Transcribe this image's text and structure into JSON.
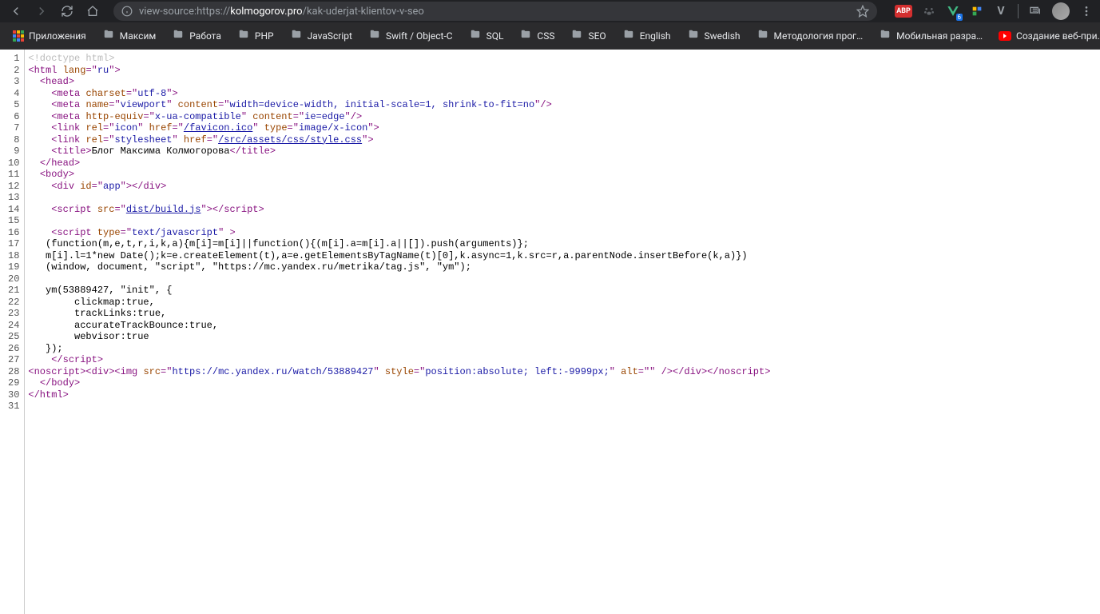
{
  "toolbar": {
    "url_prefix": "view-source:https://",
    "url_bold": "kolmogorov.pro",
    "url_rest": "/kak-uderjat-klientov-v-seo",
    "abp": "ABP",
    "badge": "6"
  },
  "bookmarks": [
    {
      "label": "Приложения",
      "type": "apps"
    },
    {
      "label": "Максим",
      "type": "folder"
    },
    {
      "label": "Работа",
      "type": "folder"
    },
    {
      "label": "PHP",
      "type": "folder"
    },
    {
      "label": "JavaScript",
      "type": "folder"
    },
    {
      "label": "Swift / Object-C",
      "type": "folder"
    },
    {
      "label": "SQL",
      "type": "folder"
    },
    {
      "label": "CSS",
      "type": "folder"
    },
    {
      "label": "SEO",
      "type": "folder"
    },
    {
      "label": "English",
      "type": "folder"
    },
    {
      "label": "Swedish",
      "type": "folder"
    },
    {
      "label": "Методология прог…",
      "type": "folder"
    },
    {
      "label": "Мобильная разра…",
      "type": "folder"
    },
    {
      "label": "Создание веб-при…",
      "type": "youtube"
    }
  ],
  "lines": [
    {
      "n": 1,
      "segs": [
        {
          "t": "<!doctype html>",
          "c": "c-doctype"
        }
      ]
    },
    {
      "n": 2,
      "segs": [
        {
          "t": "<html ",
          "c": "c-tag"
        },
        {
          "t": "lang",
          "c": "c-attr"
        },
        {
          "t": "=\"",
          "c": "c-tag"
        },
        {
          "t": "ru",
          "c": "c-val"
        },
        {
          "t": "\">",
          "c": "c-tag"
        }
      ]
    },
    {
      "n": 3,
      "segs": [
        {
          "t": "  ",
          "c": ""
        },
        {
          "t": "<head>",
          "c": "c-tag"
        }
      ]
    },
    {
      "n": 4,
      "segs": [
        {
          "t": "    ",
          "c": ""
        },
        {
          "t": "<meta ",
          "c": "c-tag"
        },
        {
          "t": "charset",
          "c": "c-attr"
        },
        {
          "t": "=\"",
          "c": "c-tag"
        },
        {
          "t": "utf-8",
          "c": "c-val"
        },
        {
          "t": "\">",
          "c": "c-tag"
        }
      ]
    },
    {
      "n": 5,
      "segs": [
        {
          "t": "    ",
          "c": ""
        },
        {
          "t": "<meta ",
          "c": "c-tag"
        },
        {
          "t": "name",
          "c": "c-attr"
        },
        {
          "t": "=\"",
          "c": "c-tag"
        },
        {
          "t": "viewport",
          "c": "c-val"
        },
        {
          "t": "\" ",
          "c": "c-tag"
        },
        {
          "t": "content",
          "c": "c-attr"
        },
        {
          "t": "=\"",
          "c": "c-tag"
        },
        {
          "t": "width=device-width, initial-scale=1, shrink-to-fit=no",
          "c": "c-val"
        },
        {
          "t": "\"/>",
          "c": "c-tag"
        }
      ]
    },
    {
      "n": 6,
      "segs": [
        {
          "t": "    ",
          "c": ""
        },
        {
          "t": "<meta ",
          "c": "c-tag"
        },
        {
          "t": "http-equiv",
          "c": "c-attr"
        },
        {
          "t": "=\"",
          "c": "c-tag"
        },
        {
          "t": "x-ua-compatible",
          "c": "c-val"
        },
        {
          "t": "\" ",
          "c": "c-tag"
        },
        {
          "t": "content",
          "c": "c-attr"
        },
        {
          "t": "=\"",
          "c": "c-tag"
        },
        {
          "t": "ie=edge",
          "c": "c-val"
        },
        {
          "t": "\"/>",
          "c": "c-tag"
        }
      ]
    },
    {
      "n": 7,
      "segs": [
        {
          "t": "    ",
          "c": ""
        },
        {
          "t": "<link ",
          "c": "c-tag"
        },
        {
          "t": "rel",
          "c": "c-attr"
        },
        {
          "t": "=\"",
          "c": "c-tag"
        },
        {
          "t": "icon",
          "c": "c-val"
        },
        {
          "t": "\" ",
          "c": "c-tag"
        },
        {
          "t": "href",
          "c": "c-attr"
        },
        {
          "t": "=\"",
          "c": "c-tag"
        },
        {
          "t": "/favicon.ico",
          "c": "c-link"
        },
        {
          "t": "\" ",
          "c": "c-tag"
        },
        {
          "t": "type",
          "c": "c-attr"
        },
        {
          "t": "=\"",
          "c": "c-tag"
        },
        {
          "t": "image/x-icon",
          "c": "c-val"
        },
        {
          "t": "\">",
          "c": "c-tag"
        }
      ]
    },
    {
      "n": 8,
      "segs": [
        {
          "t": "    ",
          "c": ""
        },
        {
          "t": "<link ",
          "c": "c-tag"
        },
        {
          "t": "rel",
          "c": "c-attr"
        },
        {
          "t": "=\"",
          "c": "c-tag"
        },
        {
          "t": "stylesheet",
          "c": "c-val"
        },
        {
          "t": "\" ",
          "c": "c-tag"
        },
        {
          "t": "href",
          "c": "c-attr"
        },
        {
          "t": "=\"",
          "c": "c-tag"
        },
        {
          "t": "/src/assets/css/style.css",
          "c": "c-link"
        },
        {
          "t": "\">",
          "c": "c-tag"
        }
      ]
    },
    {
      "n": 9,
      "segs": [
        {
          "t": "    ",
          "c": ""
        },
        {
          "t": "<title>",
          "c": "c-tag"
        },
        {
          "t": "Блог Максима Колмогорова",
          "c": "c-text"
        },
        {
          "t": "</title>",
          "c": "c-tag"
        }
      ]
    },
    {
      "n": 10,
      "segs": [
        {
          "t": "  ",
          "c": ""
        },
        {
          "t": "</head>",
          "c": "c-tag"
        }
      ]
    },
    {
      "n": 11,
      "segs": [
        {
          "t": "  ",
          "c": ""
        },
        {
          "t": "<body>",
          "c": "c-tag"
        }
      ]
    },
    {
      "n": 12,
      "segs": [
        {
          "t": "    ",
          "c": ""
        },
        {
          "t": "<div ",
          "c": "c-tag"
        },
        {
          "t": "id",
          "c": "c-attr"
        },
        {
          "t": "=\"",
          "c": "c-tag"
        },
        {
          "t": "app",
          "c": "c-val"
        },
        {
          "t": "\"></div>",
          "c": "c-tag"
        }
      ]
    },
    {
      "n": 13,
      "segs": [
        {
          "t": " ",
          "c": ""
        }
      ]
    },
    {
      "n": 14,
      "segs": [
        {
          "t": "    ",
          "c": ""
        },
        {
          "t": "<script ",
          "c": "c-tag"
        },
        {
          "t": "src",
          "c": "c-attr"
        },
        {
          "t": "=\"",
          "c": "c-tag"
        },
        {
          "t": "dist/build.js",
          "c": "c-link"
        },
        {
          "t": "\"></",
          "c": "c-tag"
        },
        {
          "t": "script>",
          "c": "c-tag"
        }
      ]
    },
    {
      "n": 15,
      "segs": [
        {
          "t": " ",
          "c": ""
        }
      ]
    },
    {
      "n": 16,
      "segs": [
        {
          "t": "    ",
          "c": ""
        },
        {
          "t": "<script ",
          "c": "c-tag"
        },
        {
          "t": "type",
          "c": "c-attr"
        },
        {
          "t": "=\"",
          "c": "c-tag"
        },
        {
          "t": "text/javascript",
          "c": "c-val"
        },
        {
          "t": "\" >",
          "c": "c-tag"
        }
      ]
    },
    {
      "n": 17,
      "segs": [
        {
          "t": "   (function(m,e,t,r,i,k,a){m[i]=m[i]||function(){(m[i].a=m[i].a||[]).push(arguments)};",
          "c": "c-text"
        }
      ]
    },
    {
      "n": 18,
      "segs": [
        {
          "t": "   m[i].l=1*new Date();k=e.createElement(t),a=e.getElementsByTagName(t)[0],k.async=1,k.src=r,a.parentNode.insertBefore(k,a)})",
          "c": "c-text"
        }
      ]
    },
    {
      "n": 19,
      "segs": [
        {
          "t": "   (window, document, \"script\", \"https://mc.yandex.ru/metrika/tag.js\", \"ym\");",
          "c": "c-text"
        }
      ]
    },
    {
      "n": 20,
      "segs": [
        {
          "t": " ",
          "c": ""
        }
      ]
    },
    {
      "n": 21,
      "segs": [
        {
          "t": "   ym(53889427, \"init\", {",
          "c": "c-text"
        }
      ]
    },
    {
      "n": 22,
      "segs": [
        {
          "t": "        clickmap:true,",
          "c": "c-text"
        }
      ]
    },
    {
      "n": 23,
      "segs": [
        {
          "t": "        trackLinks:true,",
          "c": "c-text"
        }
      ]
    },
    {
      "n": 24,
      "segs": [
        {
          "t": "        accurateTrackBounce:true,",
          "c": "c-text"
        }
      ]
    },
    {
      "n": 25,
      "segs": [
        {
          "t": "        webvisor:true",
          "c": "c-text"
        }
      ]
    },
    {
      "n": 26,
      "segs": [
        {
          "t": "   });",
          "c": "c-text"
        }
      ]
    },
    {
      "n": 27,
      "segs": [
        {
          "t": "    ",
          "c": ""
        },
        {
          "t": "</",
          "c": "c-tag"
        },
        {
          "t": "script>",
          "c": "c-tag"
        }
      ]
    },
    {
      "n": 28,
      "segs": [
        {
          "t": "<noscript><div><img ",
          "c": "c-tag"
        },
        {
          "t": "src",
          "c": "c-attr"
        },
        {
          "t": "=\"",
          "c": "c-tag"
        },
        {
          "t": "https://mc.yandex.ru/watch/53889427",
          "c": "c-val"
        },
        {
          "t": "\" ",
          "c": "c-tag"
        },
        {
          "t": "style",
          "c": "c-attr"
        },
        {
          "t": "=\"",
          "c": "c-tag"
        },
        {
          "t": "position:absolute; left:-9999px;",
          "c": "c-val"
        },
        {
          "t": "\" ",
          "c": "c-tag"
        },
        {
          "t": "alt",
          "c": "c-attr"
        },
        {
          "t": "=\"\" /></div></noscript>",
          "c": "c-tag"
        }
      ]
    },
    {
      "n": 29,
      "segs": [
        {
          "t": "  ",
          "c": ""
        },
        {
          "t": "</body>",
          "c": "c-tag"
        }
      ]
    },
    {
      "n": 30,
      "segs": [
        {
          "t": "</html>",
          "c": "c-tag"
        }
      ]
    },
    {
      "n": 31,
      "segs": [
        {
          "t": " ",
          "c": ""
        }
      ]
    }
  ]
}
